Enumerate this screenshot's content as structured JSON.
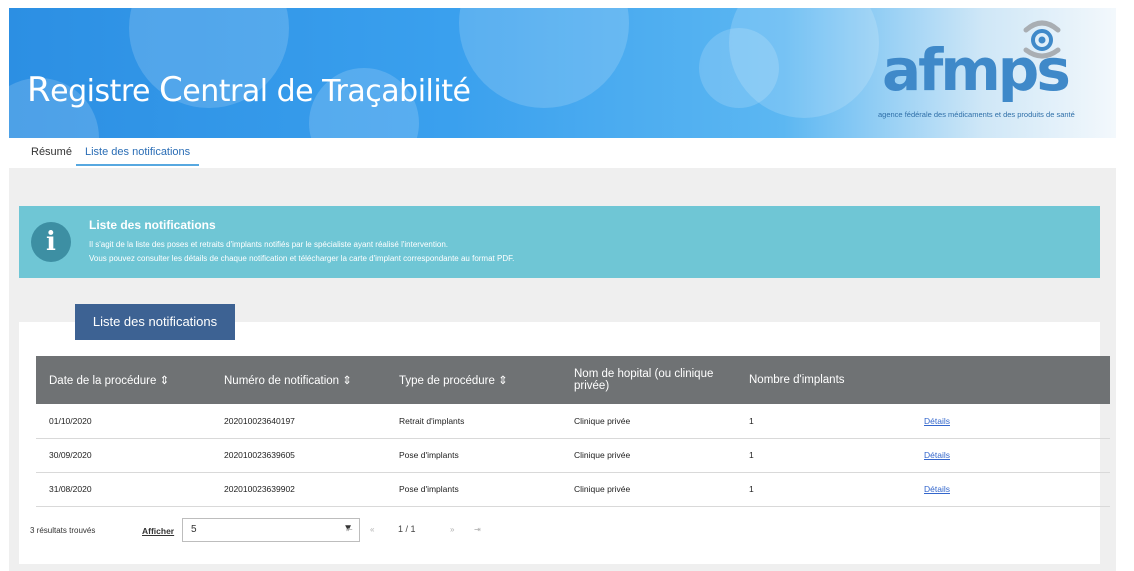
{
  "header": {
    "title_part1": "R",
    "title_part2": "egistre ",
    "title_part3": "C",
    "title_part4": "entral de Traçabilité",
    "logo_text": "afmps",
    "logo_tagline": "agence fédérale des médicaments et des produits de santé"
  },
  "tabs": [
    {
      "label": "Résumé"
    },
    {
      "label": "Liste des notifications"
    }
  ],
  "info": {
    "title": "Liste des notifications",
    "line1": "Il s'agit de la liste des poses et retraits d'implants notifiés par le spécialiste ayant réalisé l'intervention.",
    "line2": "Vous pouvez consulter les détails de chaque notification et télécharger la carte d'implant correspondante au format PDF."
  },
  "list_button": "Liste des notifications",
  "table": {
    "headers": [
      "Date de la procédure ⇕",
      "Numéro de notification ⇕",
      "Type de procédure ⇕",
      "Nom de hopital (ou clinique privée)",
      "Nombre d'implants",
      ""
    ],
    "rows": [
      [
        "01/10/2020",
        "202010023640197",
        "Retrait d'implants",
        "Clinique privée",
        "1",
        "Détails"
      ],
      [
        "30/09/2020",
        "202010023639605",
        "Pose d'implants",
        "Clinique privée",
        "1",
        "Détails"
      ],
      [
        "31/08/2020",
        "202010023639902",
        "Pose d'implants",
        "Clinique privée",
        "1",
        "Détails"
      ]
    ]
  },
  "pagination": {
    "results": "3 résultats trouvés",
    "show_label": "Afficher",
    "page_size": "5",
    "page_info": "1 / 1",
    "first": "⇤",
    "prev": "«",
    "next": "»",
    "last": "⇥"
  },
  "colors": {
    "banner": "#3aa0ee",
    "info_bg": "#6fc6d5",
    "button_bg": "#3d6293",
    "table_header": "#6f7274"
  }
}
